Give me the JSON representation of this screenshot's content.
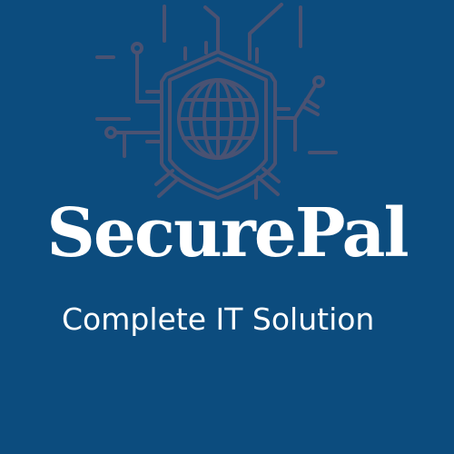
{
  "brand": {
    "name": "SecurePal",
    "tagline": "Complete IT Solution"
  },
  "icon": "shield-globe-circuit-icon",
  "colors": {
    "background": "#0c4c7e",
    "text": "#ffffff",
    "icon_top": "#f3e0e0",
    "icon_bottom": "#4a5272"
  }
}
